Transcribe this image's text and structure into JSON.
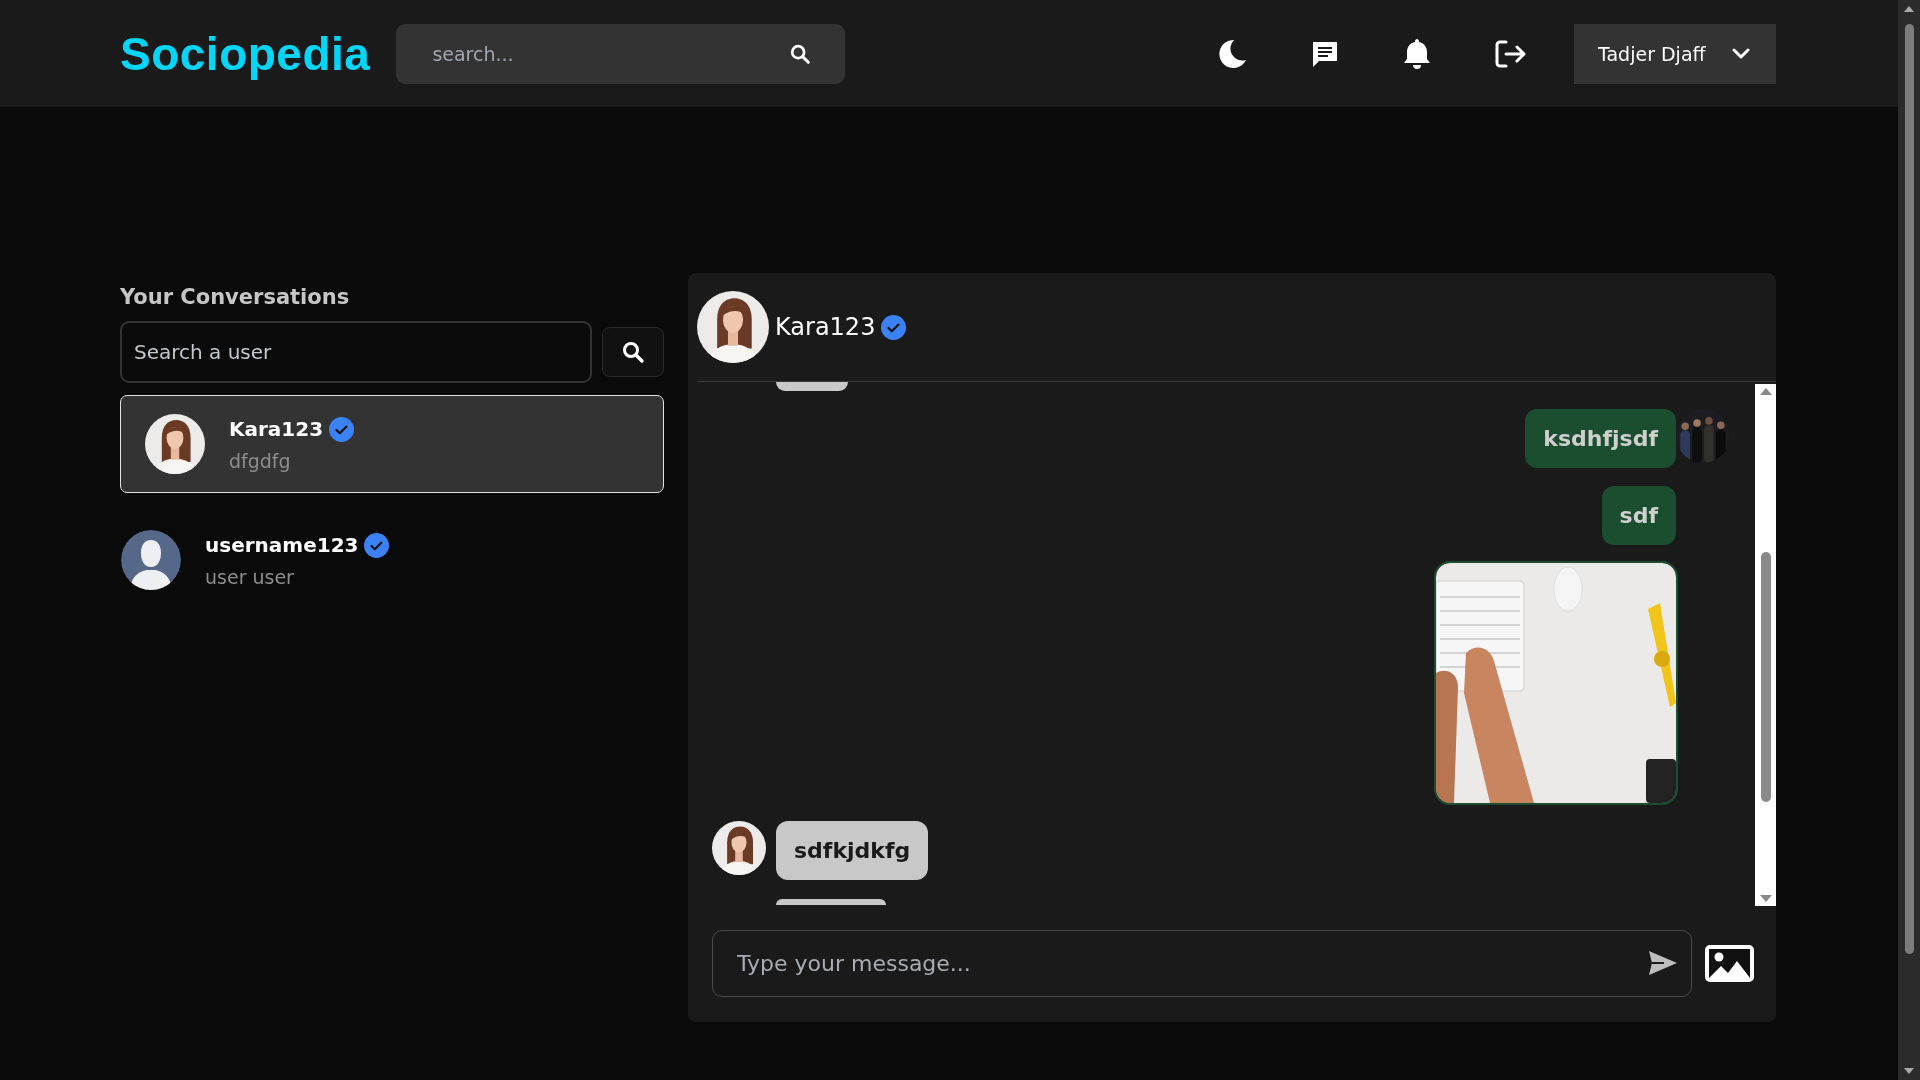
{
  "header": {
    "logo": "Sociopedia",
    "search": {
      "placeholder": "search..."
    },
    "user": {
      "name": "Tadjer Djaff"
    }
  },
  "conversations": {
    "title": "Your Conversations",
    "search": {
      "placeholder": "Search a user"
    },
    "items": [
      {
        "name": "Kara123",
        "preview": "dfgdfg",
        "verified": true,
        "selected": true
      },
      {
        "name": "username123",
        "preview": "user user",
        "verified": true,
        "kind": "default",
        "selected": false
      }
    ]
  },
  "chat": {
    "name": "Kara123",
    "verified": true,
    "messages": [
      {
        "kind": "clipped-top",
        "own": false
      },
      {
        "kind": "text",
        "own": true,
        "text": "ksdhfjsdf",
        "avatar": true
      },
      {
        "kind": "text",
        "own": true,
        "text": "sdf",
        "avatar": false
      },
      {
        "kind": "picture",
        "own": true,
        "avatar": false
      },
      {
        "kind": "text",
        "own": false,
        "text": "sdfkjdkfg",
        "avatar": true
      },
      {
        "kind": "clipped-bottom",
        "own": false
      }
    ],
    "input": {
      "placeholder": "Type your message..."
    }
  }
}
